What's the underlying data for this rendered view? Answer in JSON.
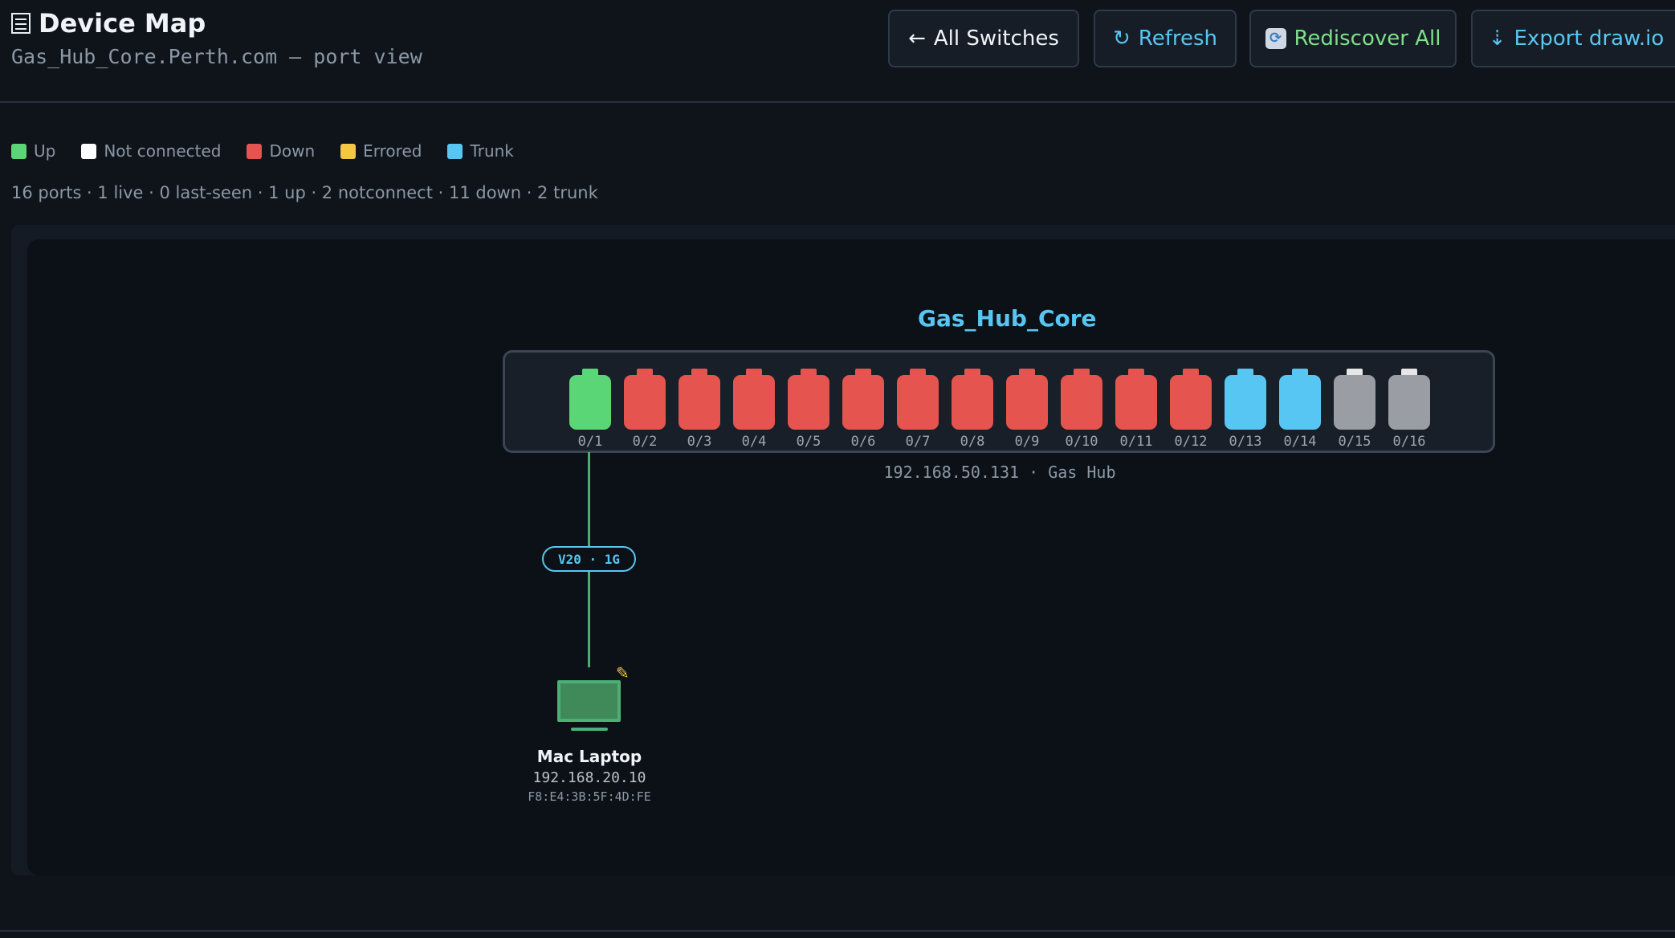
{
  "header": {
    "title": "Device Map",
    "subtitle": "Gas_Hub_Core.Perth.com — port view",
    "buttons": {
      "all_switches": {
        "icon": "←",
        "label": "All Switches"
      },
      "refresh": {
        "icon": "↻",
        "label": "Refresh"
      },
      "rediscover": {
        "icon": "⟳",
        "label": "Rediscover All"
      },
      "export": {
        "icon": "⇣",
        "label": "Export draw.io"
      }
    }
  },
  "legend": [
    {
      "label": "Up",
      "color": "#5bd676"
    },
    {
      "label": "Not connected",
      "color": "#ffffff"
    },
    {
      "label": "Down",
      "color": "#e5544e"
    },
    {
      "label": "Errored",
      "color": "#f5c842"
    },
    {
      "label": "Trunk",
      "color": "#58c6f2"
    }
  ],
  "summary": "16 ports · 1 live · 0 last-seen · 1 up · 2 notconnect · 11 down · 2 trunk",
  "switch": {
    "name": "Gas_Hub_Core",
    "info": "192.168.50.131 · Gas Hub",
    "ports": [
      {
        "label": "0/1",
        "status": "up"
      },
      {
        "label": "0/2",
        "status": "down"
      },
      {
        "label": "0/3",
        "status": "down"
      },
      {
        "label": "0/4",
        "status": "down"
      },
      {
        "label": "0/5",
        "status": "down"
      },
      {
        "label": "0/6",
        "status": "down"
      },
      {
        "label": "0/7",
        "status": "down"
      },
      {
        "label": "0/8",
        "status": "down"
      },
      {
        "label": "0/9",
        "status": "down"
      },
      {
        "label": "0/10",
        "status": "down"
      },
      {
        "label": "0/11",
        "status": "down"
      },
      {
        "label": "0/12",
        "status": "down"
      },
      {
        "label": "0/13",
        "status": "trunk"
      },
      {
        "label": "0/14",
        "status": "trunk"
      },
      {
        "label": "0/15",
        "status": "notconnect"
      },
      {
        "label": "0/16",
        "status": "notconnect"
      }
    ]
  },
  "status_colors": {
    "up": {
      "body": "#5bd676",
      "tab": "#5bd676"
    },
    "down": {
      "body": "#e5544e",
      "tab": "#e5544e"
    },
    "trunk": {
      "body": "#58c6f2",
      "tab": "#58c6f2"
    },
    "notconnect": {
      "body": "#9a9ea4",
      "tab": "#e6e6e6"
    }
  },
  "link": {
    "label": "V20 · 1G"
  },
  "device": {
    "name": "Mac Laptop",
    "ip": "192.168.20.10",
    "mac": "F8:E4:3B:5F:4D:FE",
    "icon": "monitor-icon",
    "edit_icon": "pencil-icon"
  }
}
